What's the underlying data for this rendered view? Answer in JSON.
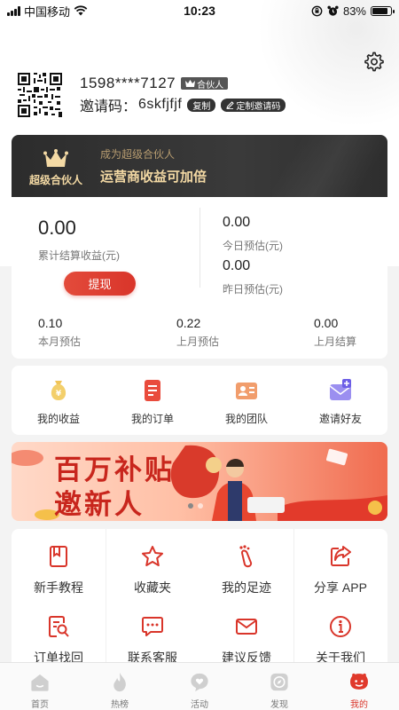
{
  "status_bar": {
    "carrier": "中国移动",
    "time": "10:23",
    "battery": "83%",
    "battery_level": 0.83
  },
  "profile": {
    "phone": "1598****7127",
    "badge": "合伙人",
    "invite_label": "邀请码：",
    "invite_code": "6skfjfjf",
    "copy_label": "复制",
    "custom_label": "定制邀请码"
  },
  "super_partner": {
    "title": "超级合伙人",
    "subtitle": "成为超级合伙人",
    "headline": "运营商收益可加倍"
  },
  "earnings": {
    "total_amount": "0.00",
    "total_label": "累计结算收益(元)",
    "withdraw_label": "提现",
    "today_amount": "0.00",
    "today_label": "今日预估(元)",
    "yesterday_amount": "0.00",
    "yesterday_label": "昨日预估(元)",
    "stats": [
      {
        "value": "0.10",
        "label": "本月预估"
      },
      {
        "value": "0.22",
        "label": "上月预估"
      },
      {
        "value": "0.00",
        "label": "上月结算"
      }
    ]
  },
  "quick_menu": [
    {
      "label": "我的收益",
      "icon": "money-bag-icon"
    },
    {
      "label": "我的订单",
      "icon": "order-icon"
    },
    {
      "label": "我的团队",
      "icon": "team-card-icon"
    },
    {
      "label": "邀请好友",
      "icon": "invite-envelope-icon"
    }
  ],
  "promo": {
    "line1": "百万补贴",
    "line2": "邀新人"
  },
  "services": [
    {
      "label": "新手教程",
      "icon": "book-icon"
    },
    {
      "label": "收藏夹",
      "icon": "star-icon"
    },
    {
      "label": "我的足迹",
      "icon": "footprint-icon"
    },
    {
      "label": "分享 APP",
      "icon": "share-icon"
    },
    {
      "label": "订单找回",
      "icon": "order-search-icon"
    },
    {
      "label": "联系客服",
      "icon": "chat-icon"
    },
    {
      "label": "建议反馈",
      "icon": "mail-icon"
    },
    {
      "label": "关于我们",
      "icon": "info-icon"
    }
  ],
  "tabs": [
    {
      "label": "首页",
      "icon": "home-icon",
      "active": false
    },
    {
      "label": "热榜",
      "icon": "flame-icon",
      "active": false
    },
    {
      "label": "活动",
      "icon": "heart-bubble-icon",
      "active": false
    },
    {
      "label": "发现",
      "icon": "compass-icon",
      "active": false
    },
    {
      "label": "我的",
      "icon": "smiley-icon",
      "active": true
    }
  ],
  "colors": {
    "accent": "#d9352a",
    "gold": "#f3d9a4",
    "dark_banner": "#2f2f2f",
    "tab_inactive": "#cfcfcf"
  }
}
